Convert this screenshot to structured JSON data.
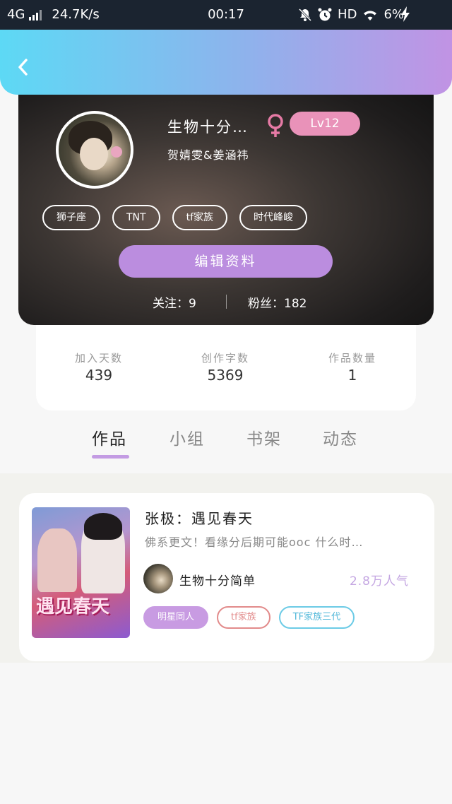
{
  "status_bar": {
    "network": "4G",
    "speed": "24.7K/s",
    "time": "00:17",
    "hd": "HD",
    "battery": "6%"
  },
  "header": {
    "back_icon": "chevron-left-icon"
  },
  "profile": {
    "nickname": "生物十分…",
    "gender_icon": "female-icon",
    "level": "Lv12",
    "subtitle": "贺婧雯&姜涵祎",
    "tags": [
      "狮子座",
      "TNT",
      "tf家族",
      "时代峰峻"
    ],
    "edit_button": "编辑资料",
    "following_label": "关注：9",
    "followers_label": "粉丝：182"
  },
  "stats": [
    {
      "label": "加入天数",
      "value": "439"
    },
    {
      "label": "创作字数",
      "value": "5369"
    },
    {
      "label": "作品数量",
      "value": "1"
    }
  ],
  "tabs": [
    "作品",
    "小组",
    "书架",
    "动态"
  ],
  "active_tab": "作品",
  "works": [
    {
      "title": "张极：遇见春天",
      "description": "佛系更文！看缘分后期可能ooc 什么时…",
      "cover_text": "遇见春天",
      "author": "生物十分简单",
      "popularity": "2.8万人气",
      "tags": [
        {
          "label": "明星同人",
          "color": "#ffffff",
          "bg": "#c89be2",
          "border": "#c89be2"
        },
        {
          "label": "tf家族",
          "color": "#e28b8b",
          "bg": "#ffffff",
          "border": "#e28b8b"
        },
        {
          "label": "TF家族三代",
          "color": "#4fb7d9",
          "bg": "#ffffff",
          "border": "#6ccbe6"
        }
      ]
    }
  ],
  "colors": {
    "header_gradient": [
      "#5dd9f5",
      "#c193e4"
    ],
    "accent": "#c39be3",
    "level_badge": "#e992b9",
    "gender": "#e67aa5"
  }
}
